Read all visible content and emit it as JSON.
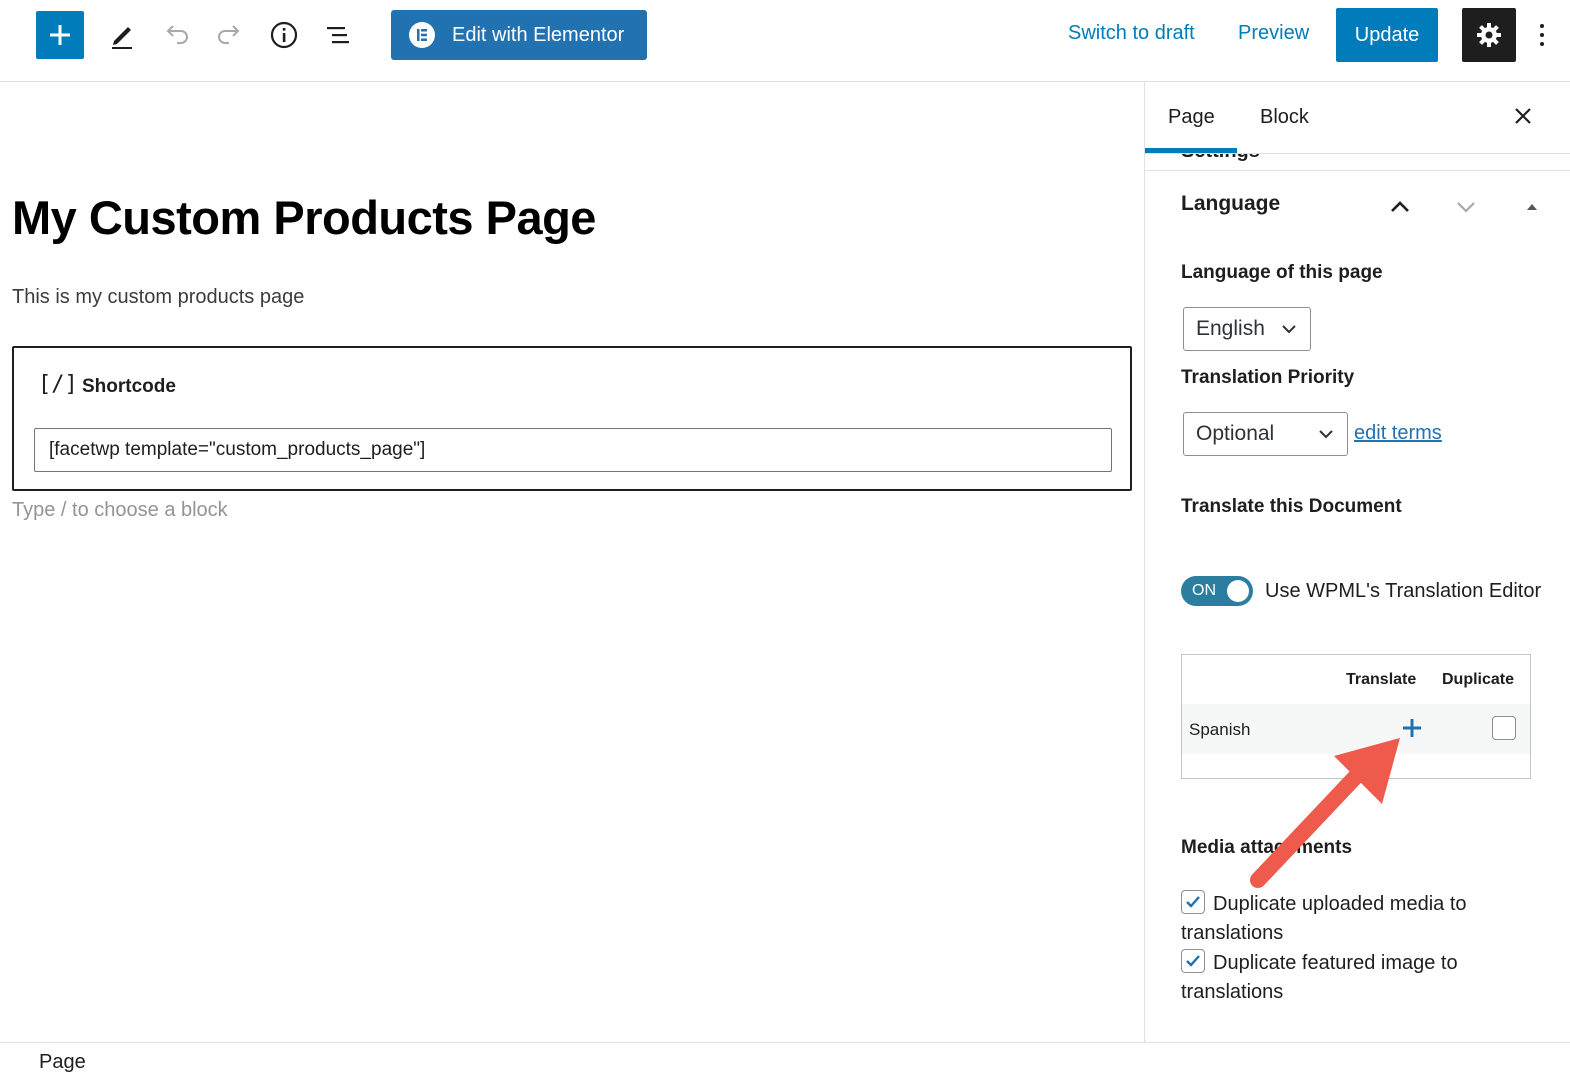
{
  "toolbar": {
    "elementor_label": "Edit with Elementor",
    "switch_to_draft": "Switch to draft",
    "preview": "Preview",
    "update": "Update"
  },
  "editor": {
    "title": "My Custom Products Page",
    "paragraph": "This is my custom products page",
    "shortcode_block": {
      "icon_text": "[/]",
      "label": "Shortcode",
      "value": "[facetwp template=\"custom_products_page\"]"
    },
    "appender_hint": "Type / to choose a block"
  },
  "sidebar": {
    "tabs": [
      "Page",
      "Block"
    ],
    "active_tab": "Page",
    "cut_heading": "Settings",
    "panel_title": "Language",
    "language_label": "Language of this page",
    "language_value": "English",
    "priority_label": "Translation Priority",
    "priority_value": "Optional",
    "edit_terms": "edit terms",
    "translate_doc_label": "Translate this Document",
    "toggle_state": "ON",
    "toggle_label": "Use WPML's Translation Editor",
    "table": {
      "headers": [
        "Translate",
        "Duplicate"
      ],
      "rows": [
        {
          "language": "Spanish"
        }
      ]
    },
    "media_label": "Media attachments",
    "checkboxes": [
      {
        "label": "Duplicate uploaded media to translations",
        "checked": true
      },
      {
        "label": "Duplicate featured image to translations",
        "checked": true
      }
    ]
  },
  "footer": {
    "breadcrumb": "Page"
  },
  "colors": {
    "primary": "#007cba",
    "annotation_arrow": "#ee5a4c",
    "toggle_on": "#2c7ea1"
  }
}
